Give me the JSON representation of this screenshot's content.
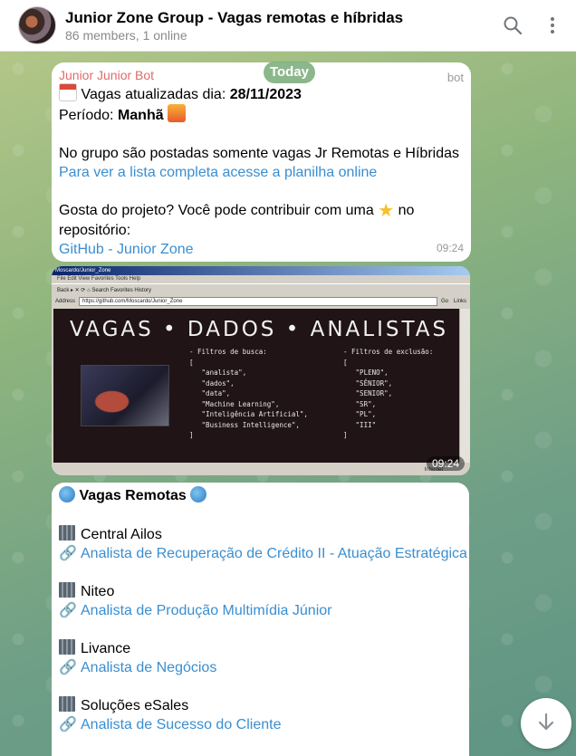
{
  "header": {
    "title": "Junior Zone Group - Vagas remotas e híbridas",
    "subtitle": "86 members, 1 online"
  },
  "date_badge": "Today",
  "message1": {
    "sender": "Junior Junior Bot",
    "tag": "bot",
    "line1_prefix": "Vagas atualizadas dia: ",
    "line1_date": "28/11/2023",
    "line2_prefix": "Período: ",
    "line2_value": "Manhã",
    "line3": "No grupo são postadas somente vagas Jr Remotas e Híbridas",
    "link1": "Para ver a lista completa acesse a planilha online",
    "line4a": "Gosta do projeto? Você pode contribuir com uma",
    "line4b": "no",
    "line5": "repositório:",
    "link2": "GitHub - Junior Zone",
    "time": "09:24"
  },
  "image_message": {
    "browser_title": "Moscardo/Junior_Zone",
    "browser_menu": "File   Edit   View   Favorites   Tools   Help",
    "browser_toolbar": "Back  ▸  ✕  ⟳  ⌂   Search   Favorites   History",
    "address_label": "Address",
    "address_url": "https://github.com/Moscardo/Junior_Zone",
    "go_label": "Go",
    "links_label": "Links",
    "banner_title": "VAGAS • DADOS • ANALISTAS",
    "filters_left": "- Filtros de busca:\n[\n   \"analista\",\n   \"dados\",\n   \"data\",\n   \"Machine Learning\",\n   \"Inteligência Artificial\",\n   \"Business Intelligence\",\n]",
    "filters_right": "- Filtros de exclusão:\n[\n   \"PLENO\",\n   \"SÊNIOR\",\n   \"SENIOR\",\n   \"SR\",\n   \"PL\",\n   \"III\"\n]",
    "status_text": "Internet",
    "time": "09:24"
  },
  "message2": {
    "heading": "Vagas Remotas",
    "jobs": [
      {
        "company": "Central Ailos",
        "role": "Analista de Recuperação de Crédito II - Atuação Estratégica"
      },
      {
        "company": "Niteo",
        "role": "Analista de Produção Multimídia Júnior"
      },
      {
        "company": "Livance",
        "role": "Analista de Negócios"
      },
      {
        "company": "Soluções eSales",
        "role": "Analista de Sucesso do Cliente"
      }
    ]
  },
  "icons": {
    "search": "search-icon",
    "menu": "more-vertical-icon",
    "scroll_down": "arrow-down-icon"
  },
  "colors": {
    "link": "#3a8ed0",
    "sender": "#e06b6b",
    "header_bg": "#ffffff"
  }
}
